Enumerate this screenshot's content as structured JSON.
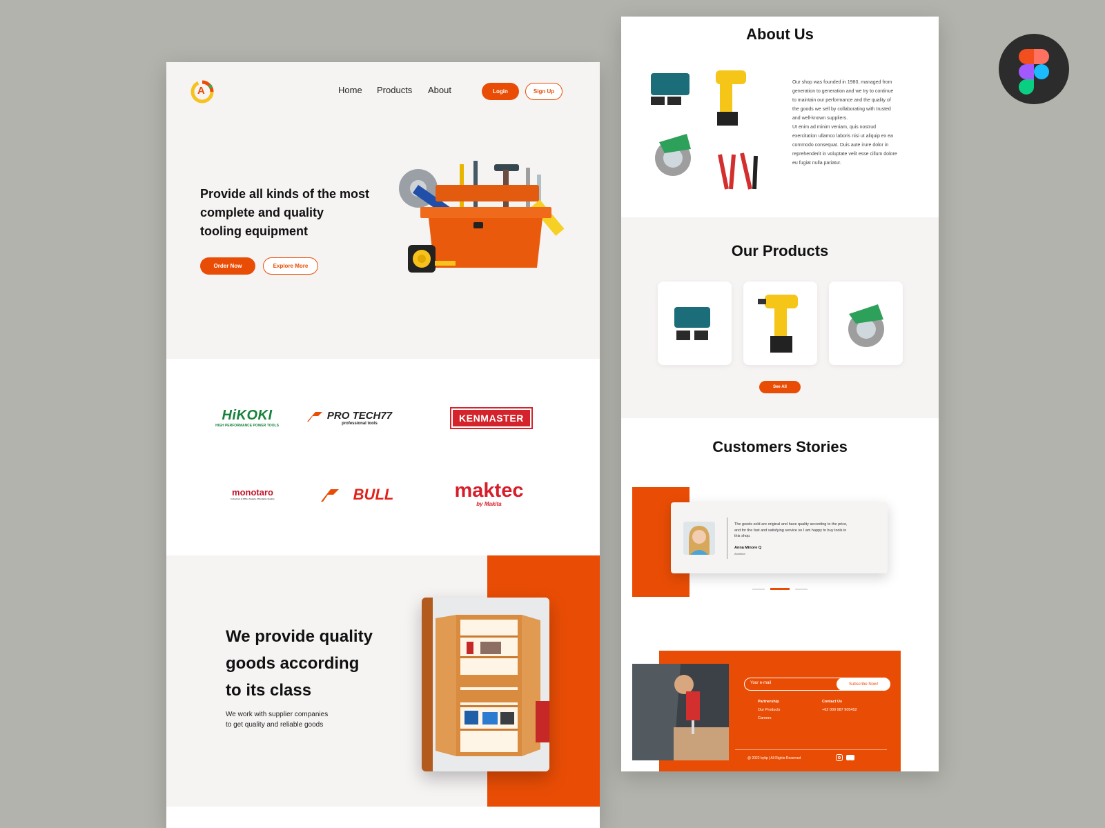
{
  "logo": {
    "text": "A"
  },
  "nav": {
    "home": "Home",
    "products": "Products",
    "about": "About",
    "login": "Login",
    "signup": "Sign Up"
  },
  "hero": {
    "title_line1": "Provide all kinds of the most",
    "title_line2": "complete and quality",
    "title_line3": "tooling equipment",
    "order_now": "Order Now",
    "explore_more": "Explore More"
  },
  "brands": {
    "hikoki": "HiKOKI",
    "hikoki_sub": "HIGH PERFORMANCE POWER TOOLS",
    "protech": "PRO TECH77",
    "protech_sub": "professional tools",
    "kenmaster": "KENMASTER",
    "monotaro": "monotaro",
    "monotaro_sub": "Industrial & Office Supply Affordable Quality",
    "bull": "BULL",
    "maktec": "maktec",
    "maktec_sub": "by Makita"
  },
  "quality": {
    "title_line1": "We provide quality",
    "title_line2": "goods according",
    "title_line3": "to its class",
    "sub_line1": "We work with supplier companies",
    "sub_line2": "to get quality and reliable goods"
  },
  "about": {
    "title": "About Us",
    "lines": [
      "Our shop was founded in 1980, managed from",
      "generation to generation and we try to continue",
      "to maintain our performance and the quality of",
      "the goods we sell by collaborating with trusted",
      "and well-known suppliers.",
      "Ut enim ad minim veniam, quis nostrud",
      "exercitation ullamco laboris nisi ut aliquip ex ea",
      "commodo consequat. Duis aute irure dolor in",
      "reprehenderit in voluptate velit esse cillum dolore",
      "eu fugiat nulla pariatur."
    ]
  },
  "products": {
    "title": "Our Products",
    "see_all": "See All"
  },
  "stories": {
    "title": "Customers Stories",
    "quote_line1": "The goods sold are original and have quality according to the price,",
    "quote_line2": "and for the fast and satisfying service so I am happy to buy tools in",
    "quote_line3": "this shop.",
    "name": "Anna Minore Q",
    "role": "Architect"
  },
  "footer": {
    "email_placeholder": "Your e-mail",
    "subscribe": "Subscribe Now!",
    "partnership": "Partnership",
    "our_products": "Our Products",
    "careers": "Careers",
    "contact_us": "Contact Us",
    "phone": "+62 000 987 905452",
    "copyright": "@ 2022 bytip | All Rights Reserved"
  },
  "colors": {
    "accent": "#e94d05",
    "page_bg": "#f6f3f3",
    "backdrop": "#b3b3ad"
  },
  "icons": [
    "figma-icon",
    "instagram-icon",
    "youtube-icon"
  ]
}
